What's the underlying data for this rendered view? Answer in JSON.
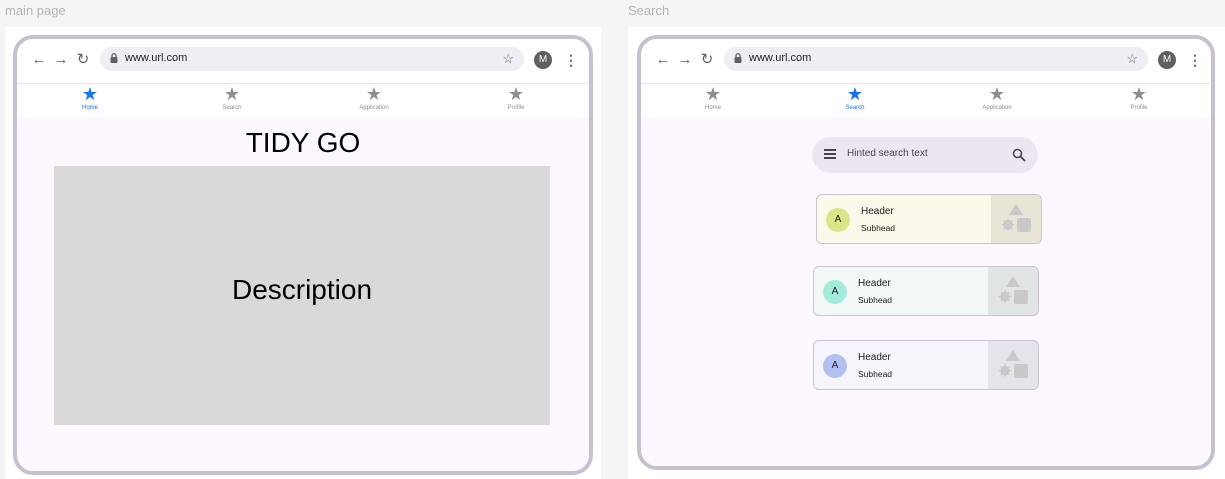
{
  "frames": [
    {
      "label": "main page",
      "browser": {
        "url": "www.url.com",
        "avatar_letter": "M"
      },
      "tabs": [
        {
          "label": "Home",
          "active": true
        },
        {
          "label": "Search",
          "active": false
        },
        {
          "label": "Application",
          "active": false
        },
        {
          "label": "Profile",
          "active": false
        }
      ],
      "title": "TIDY GO",
      "description": "Description"
    },
    {
      "label": "Search",
      "browser": {
        "url": "www.url.com",
        "avatar_letter": "M"
      },
      "tabs": [
        {
          "label": "Home",
          "active": false
        },
        {
          "label": "Search",
          "active": true
        },
        {
          "label": "Application",
          "active": false
        },
        {
          "label": "Profile",
          "active": false
        }
      ],
      "search": {
        "placeholder": "Hinted search text"
      },
      "cards": [
        {
          "avatar": "A",
          "header": "Header",
          "subhead": "Subhead",
          "bg": "#fbf9e9",
          "media_bg": "#e8e5d6",
          "avatar_bg": "#dce48a"
        },
        {
          "avatar": "A",
          "header": "Header",
          "subhead": "Subhead",
          "bg": "#f1f8f5",
          "media_bg": "#e1e5e3",
          "avatar_bg": "#a3ecdc"
        },
        {
          "avatar": "A",
          "header": "Header",
          "subhead": "Subhead",
          "bg": "#f6f5fb",
          "media_bg": "#e5e4ea",
          "avatar_bg": "#b1c2f2"
        }
      ]
    }
  ],
  "colors": {
    "accent": "#1a73e8",
    "frame_border": "#c7c0cf",
    "device_bg": "#fdf7ff"
  },
  "icons": {
    "tab": "star-icon",
    "back": "arrow-left-icon",
    "forward": "arrow-right-icon",
    "reload": "reload-icon",
    "lock": "lock-icon",
    "bookmark": "star-outline-icon",
    "menu": "kebab-icon",
    "search": "search-icon",
    "hamburger": "hamburger-icon",
    "media": "shapes-icon"
  }
}
